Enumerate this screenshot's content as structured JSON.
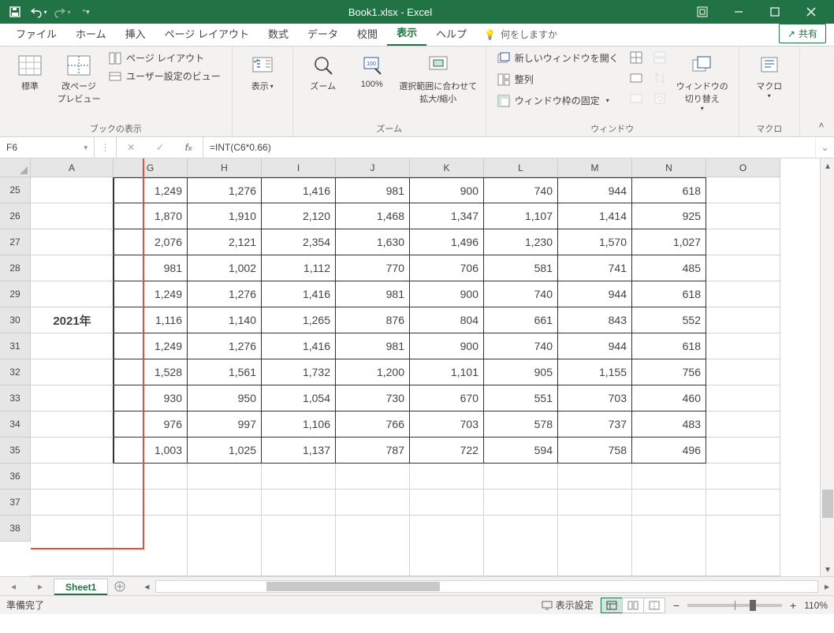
{
  "app": {
    "title": "Book1.xlsx  -  Excel"
  },
  "tabs": {
    "file": "ファイル",
    "home": "ホーム",
    "insert": "挿入",
    "pagelayout": "ページ レイアウト",
    "formulas": "数式",
    "data": "データ",
    "review": "校閲",
    "view": "表示",
    "help": "ヘルプ",
    "tellme": "何をしますか"
  },
  "share": "共有",
  "ribbon": {
    "views": {
      "normal": "標準",
      "pagebreak": "改ページ\nプレビュー",
      "pagelayout": "ページ レイアウト",
      "custom": "ユーザー設定のビュー",
      "group": "ブックの表示"
    },
    "show": {
      "label": "表示"
    },
    "zoom": {
      "zoom": "ズーム",
      "p100": "100%",
      "fit": "選択範囲に合わせて\n拡大/縮小",
      "group": "ズーム"
    },
    "window": {
      "newwin": "新しいウィンドウを開く",
      "arrange": "整列",
      "freeze": "ウィンドウ枠の固定",
      "switch": "ウィンドウの\n切り替え",
      "group": "ウィンドウ"
    },
    "macro": {
      "label": "マクロ",
      "group": "マクロ"
    }
  },
  "namebox": "F6",
  "formula": "=INT(C6*0.66)",
  "columns": [
    "A",
    "G",
    "H",
    "I",
    "J",
    "K",
    "L",
    "M",
    "N",
    "O"
  ],
  "rows": [
    "25",
    "26",
    "27",
    "28",
    "29",
    "30",
    "31",
    "32",
    "33",
    "34",
    "35",
    "36",
    "37",
    "38"
  ],
  "merged_A_label": "2021年",
  "chart_data": {
    "type": "table",
    "row_labels": [
      "25",
      "26",
      "27",
      "28",
      "29",
      "30",
      "31",
      "32",
      "33",
      "34",
      "35"
    ],
    "columns": [
      "G",
      "H",
      "I",
      "J",
      "K",
      "L",
      "M",
      "N"
    ],
    "values": [
      [
        1249,
        1276,
        1416,
        981,
        900,
        740,
        944,
        618
      ],
      [
        1870,
        1910,
        2120,
        1468,
        1347,
        1107,
        1414,
        925
      ],
      [
        2076,
        2121,
        2354,
        1630,
        1496,
        1230,
        1570,
        1027
      ],
      [
        981,
        1002,
        1112,
        770,
        706,
        581,
        741,
        485
      ],
      [
        1249,
        1276,
        1416,
        981,
        900,
        740,
        944,
        618
      ],
      [
        1116,
        1140,
        1265,
        876,
        804,
        661,
        843,
        552
      ],
      [
        1249,
        1276,
        1416,
        981,
        900,
        740,
        944,
        618
      ],
      [
        1528,
        1561,
        1732,
        1200,
        1101,
        905,
        1155,
        756
      ],
      [
        930,
        950,
        1054,
        730,
        670,
        551,
        703,
        460
      ],
      [
        976,
        997,
        1106,
        766,
        703,
        578,
        737,
        483
      ],
      [
        1003,
        1025,
        1137,
        787,
        722,
        594,
        758,
        496
      ]
    ]
  },
  "sheet": {
    "name": "Sheet1"
  },
  "status": {
    "ready": "準備完了",
    "display": "表示設定",
    "zoom": "110%"
  }
}
